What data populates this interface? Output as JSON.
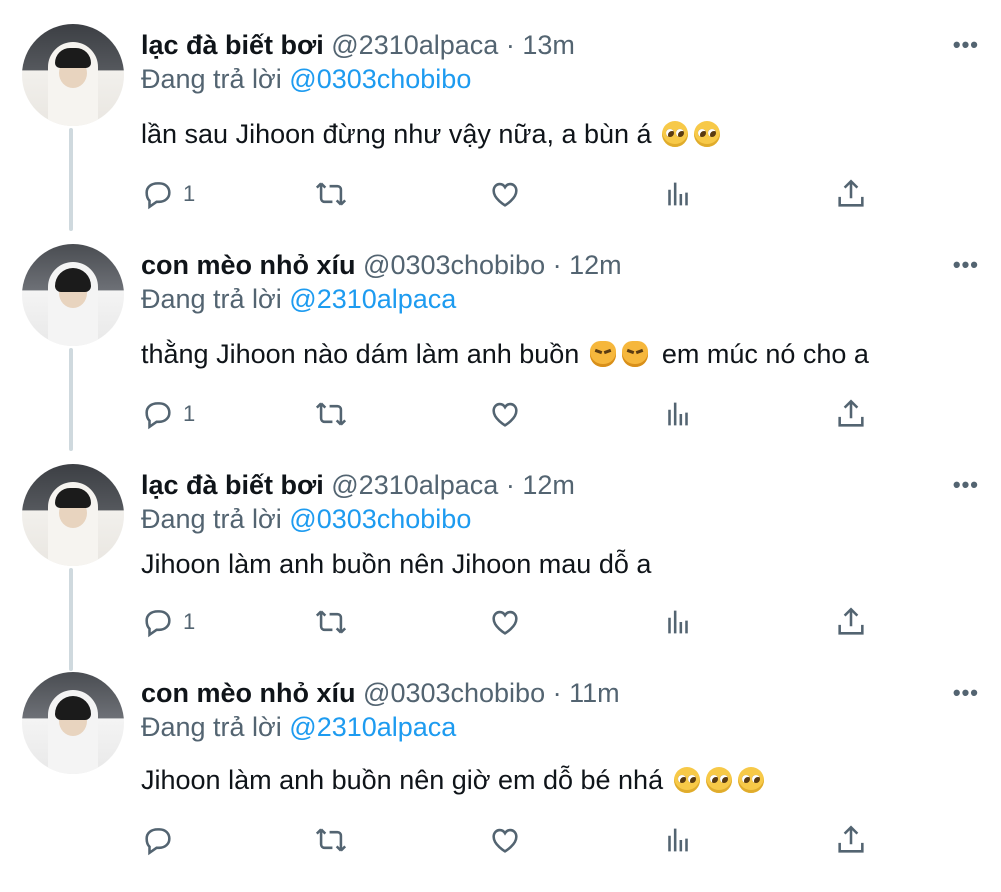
{
  "replying_prefix": "Đang trả lời",
  "tweets": [
    {
      "name": "lạc đà biết bơi",
      "handle": "@2310alpaca",
      "time": "· 13m",
      "reply_to": "@0303chobibo",
      "text_before": "lần sau Jihoon đừng như vậy nữa, a bùn á",
      "text_after": "",
      "emojis": [
        "pleading-face",
        "pleading-face"
      ],
      "reply_count": "1"
    },
    {
      "name": "con mèo nhỏ xíu",
      "handle": "@0303chobibo",
      "time": "· 12m",
      "reply_to": "@2310alpaca",
      "text_before": "thằng Jihoon nào dám làm anh buồn",
      "text_after": "em múc nó cho a",
      "emojis": [
        "pouting-cat",
        "pouting-cat"
      ],
      "reply_count": "1"
    },
    {
      "name": "lạc đà biết bơi",
      "handle": "@2310alpaca",
      "time": "· 12m",
      "reply_to": "@0303chobibo",
      "text_before": "Jihoon làm anh buồn nên Jihoon mau dỗ a",
      "text_after": "",
      "emojis": [],
      "reply_count": "1"
    },
    {
      "name": "con mèo nhỏ xíu",
      "handle": "@0303chobibo",
      "time": "· 11m",
      "reply_to": "@2310alpaca",
      "text_before": "Jihoon làm anh buồn nên giờ em dỗ bé nhá",
      "text_after": "",
      "emojis": [
        "pleading-face",
        "pleading-face",
        "pleading-face"
      ],
      "reply_count": ""
    }
  ],
  "more_label": "•••",
  "icons": [
    "reply-icon",
    "retweet-icon",
    "like-icon",
    "analytics-icon",
    "share-icon",
    "more-icon"
  ],
  "colors": {
    "mention": "#1d9bf0",
    "secondary": "#536471",
    "thread_line": "#cfd9de"
  }
}
